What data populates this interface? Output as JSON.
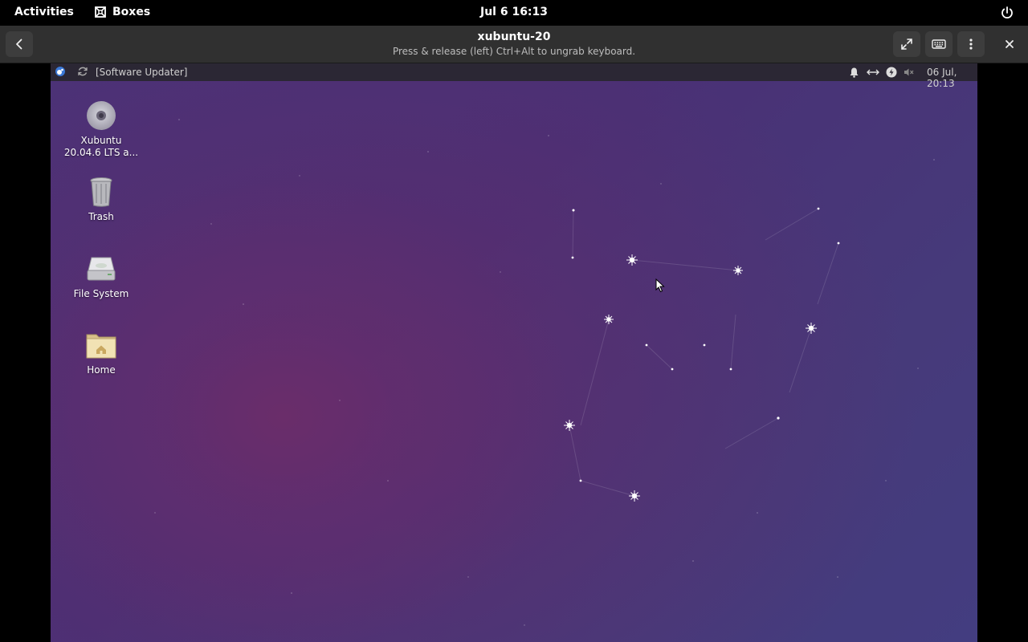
{
  "topbar": {
    "activities": "Activities",
    "app_name": "Boxes",
    "app_icon": "boxes-icon",
    "clock": "Jul 6  16:13",
    "power_icon": "power-icon"
  },
  "headerbar": {
    "title": "xubuntu-20",
    "subtitle": "Press & release (left) Ctrl+Alt to ungrab keyboard.",
    "back_icon": "back-arrow-icon",
    "fullscreen_icon": "fullscreen-icon",
    "keyboard_icon": "keyboard-icon",
    "menu_icon": "kebab-menu-icon",
    "close_icon": "close-icon"
  },
  "guest_panel": {
    "whisker_icon": "xubuntu-mouse-icon",
    "updater_icon": "refresh-icon",
    "task_label": "[Software Updater]",
    "tray_icons": [
      "bell-icon",
      "network-icon",
      "update-icon",
      "volume-muted-icon"
    ],
    "datetime": "06 Jul, 20:13"
  },
  "desktop_icons": [
    {
      "line1": "Xubuntu",
      "line2": "20.04.6 LTS a...",
      "icon": "disc-icon"
    },
    {
      "line1": "Trash",
      "line2": "",
      "icon": "trash-icon"
    },
    {
      "line1": "File System",
      "line2": "",
      "icon": "drive-icon"
    },
    {
      "line1": "Home",
      "line2": "",
      "icon": "home-folder-icon"
    }
  ],
  "colors": {
    "topbar_bg": "#000000",
    "headerbar_bg": "#303030",
    "desktop_purple": "#4b3277",
    "desktop_magenta": "#6a2d6a"
  }
}
